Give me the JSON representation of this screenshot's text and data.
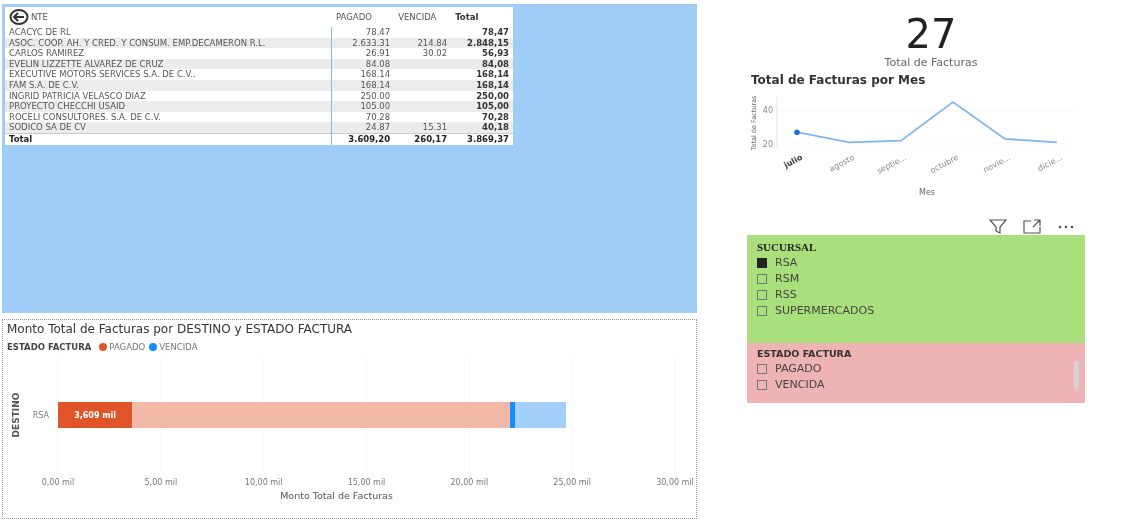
{
  "table": {
    "columns": [
      "NTE",
      "PAGADO",
      "VENCIDA",
      "Total"
    ],
    "rows": [
      {
        "client": "ACACYC DE RL",
        "pagado": "78.47",
        "vencida": "",
        "total": "78,47"
      },
      {
        "client": "ASOC. COOP. AH. Y CRED. Y CONSUM. EMP.DECAMERON R.L.",
        "pagado": "2.633.31",
        "vencida": "214.84",
        "total": "2.848,15"
      },
      {
        "client": "CARLOS RAMIREZ",
        "pagado": "26.91",
        "vencida": "30.02",
        "total": "56,93"
      },
      {
        "client": "EVELIN LIZZETTE ALVAREZ DE CRUZ",
        "pagado": "84.08",
        "vencida": "",
        "total": "84,08"
      },
      {
        "client": "EXECUTIVE MOTORS SERVICES S.A. DE C.V..",
        "pagado": "168.14",
        "vencida": "",
        "total": "168,14"
      },
      {
        "client": "FAM S.A. DE C.V.",
        "pagado": "168.14",
        "vencida": "",
        "total": "168,14"
      },
      {
        "client": "INGRID PATRICIA VELASCO DIAZ",
        "pagado": "250.00",
        "vencida": "",
        "total": "250,00"
      },
      {
        "client": "PROYECTO CHECCHI USAID",
        "pagado": "105.00",
        "vencida": "",
        "total": "105,00"
      },
      {
        "client": "ROCELI CONSULTORES. S.A. DE C.V.",
        "pagado": "70.28",
        "vencida": "",
        "total": "70,28"
      },
      {
        "client": "SODICO SA DE CV",
        "pagado": "24.87",
        "vencida": "15.31",
        "total": "40,18"
      }
    ],
    "total_row": {
      "client": "Total",
      "pagado": "3.609,20",
      "vencida": "260,17",
      "total": "3.869,37"
    }
  },
  "bar_chart": {
    "chart_data": {
      "type": "bar",
      "orientation": "horizontal",
      "stacked": true,
      "title": "Monto Total de Facturas por DESTINO y ESTADO FACTURA",
      "xlabel": "Monto Total de Facturas",
      "ylabel": "DESTINO",
      "categories": [
        "RSA"
      ],
      "series": [
        {
          "name": "PAGADO",
          "color": "#e0542a",
          "values": [
            3.609
          ]
        },
        {
          "color": "#f2b9a8",
          "values": [
            18.37
          ]
        },
        {
          "name": "VENCIDA",
          "color": "#118dff",
          "values": [
            0.26
          ]
        },
        {
          "color": "#a3d0fb",
          "values": [
            2.46
          ]
        }
      ],
      "grid": true,
      "xlim": [
        0,
        30
      ],
      "xticks": [
        {
          "value": 0,
          "label": "0,00 mil"
        },
        {
          "value": 5,
          "label": "5,00 mil"
        },
        {
          "value": 10,
          "label": "10,00 mil"
        },
        {
          "value": 15,
          "label": "15,00 mil"
        },
        {
          "value": 20,
          "label": "20,00 mil"
        },
        {
          "value": 25,
          "label": "25,00 mil"
        },
        {
          "value": 30,
          "label": "30,00 mil"
        }
      ],
      "annotations": [
        "3,609 mil"
      ]
    },
    "legend_title": "ESTADO FACTURA"
  },
  "card": {
    "value": "27",
    "label": "Total de Facturas"
  },
  "line_chart": {
    "chart_data": {
      "type": "line",
      "title": "Total de Facturas por Mes",
      "xlabel": "Mes",
      "ylabel": "Total de Facturas",
      "categories": [
        "julio",
        "agosto",
        "septie...",
        "octubre",
        "novie...",
        "dicie..."
      ],
      "series": [
        {
          "color": "#7fb6ec",
          "values": [
            27,
            21,
            22,
            45,
            23,
            21
          ]
        }
      ],
      "ylim": [
        17,
        48
      ],
      "yticks": [
        20,
        40
      ]
    }
  },
  "slicer_sucursal": {
    "title": "SUCURSAL",
    "items": [
      {
        "label": "RSA",
        "checked": true
      },
      {
        "label": "RSM",
        "checked": false
      },
      {
        "label": "RSS",
        "checked": false
      },
      {
        "label": "SUPERMERCADOS",
        "checked": false
      }
    ]
  },
  "slicer_estado": {
    "title": "ESTADO FACTURA",
    "items": [
      {
        "label": "PAGADO",
        "checked": false
      },
      {
        "label": "VENCIDA",
        "checked": false
      }
    ]
  }
}
